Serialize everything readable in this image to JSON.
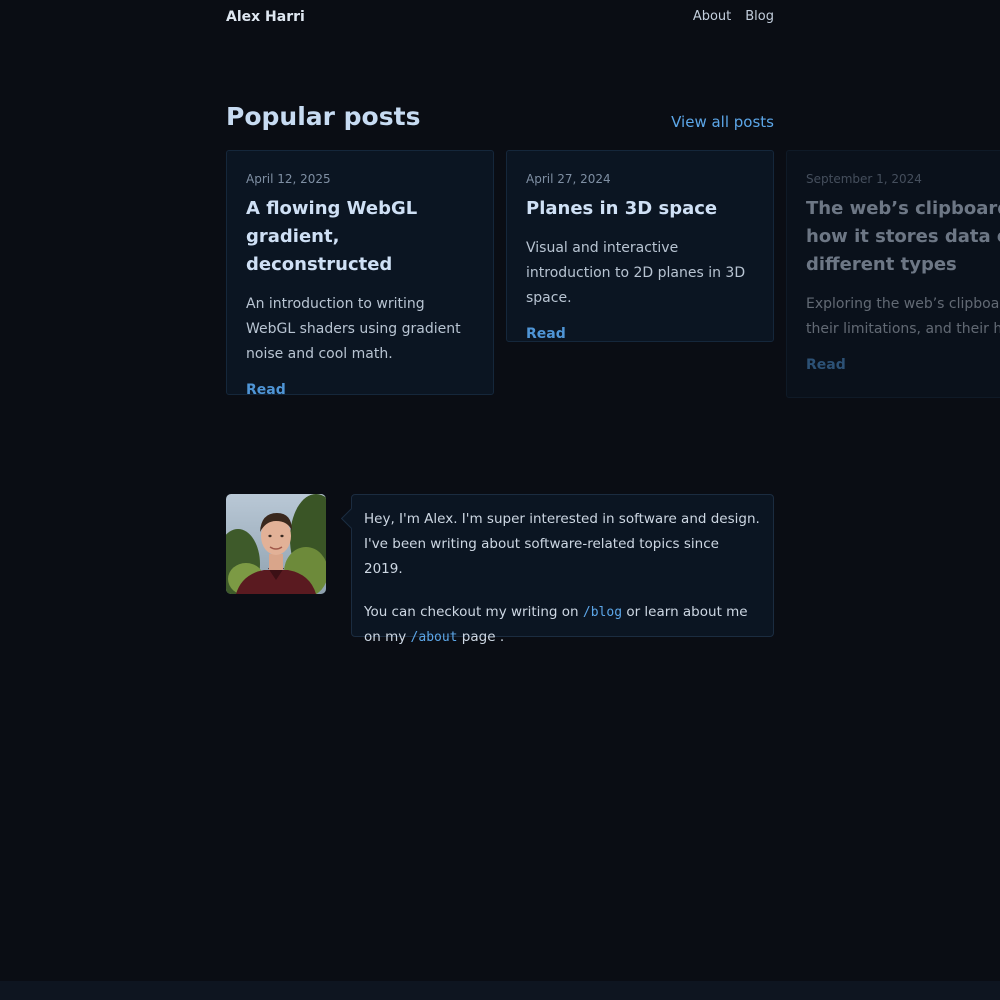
{
  "header": {
    "site_name": "Alex Harri",
    "nav": [
      {
        "label": "About"
      },
      {
        "label": "Blog"
      }
    ]
  },
  "popular": {
    "title": "Popular posts",
    "view_all": "View all posts",
    "posts": [
      {
        "date": "April 12, 2025",
        "title": "A flowing WebGL gradient, deconstructed",
        "description": "An introduction to writing WebGL shaders using gradient noise and cool math.",
        "read": "Read"
      },
      {
        "date": "April 27, 2024",
        "title": "Planes in 3D space",
        "description": "Visual and interactive introduction to 2D planes in 3D space.",
        "read": "Read"
      },
      {
        "date": "September 1, 2024",
        "title": "The web’s clipboard, and how it stores data of different types",
        "description": "Exploring the web’s clipboard APIs, their limitations, and their history.",
        "read": "Read"
      }
    ]
  },
  "intro": {
    "p1": "Hey, I'm Alex. I'm super interested in software and design. I've been writing about software-related topics since 2019.",
    "p2_before": "You can checkout my writing on ",
    "blog_link": "/blog",
    "p2_middle": " or learn about me on my ",
    "about_link": "/about",
    "p2_after": " page ."
  },
  "colors": {
    "background": "#0a0d14",
    "card": "#0b1522",
    "accent": "#5ca6e8",
    "heading": "#c7dbf2"
  },
  "icons": {
    "avatar": "portrait-photo"
  }
}
